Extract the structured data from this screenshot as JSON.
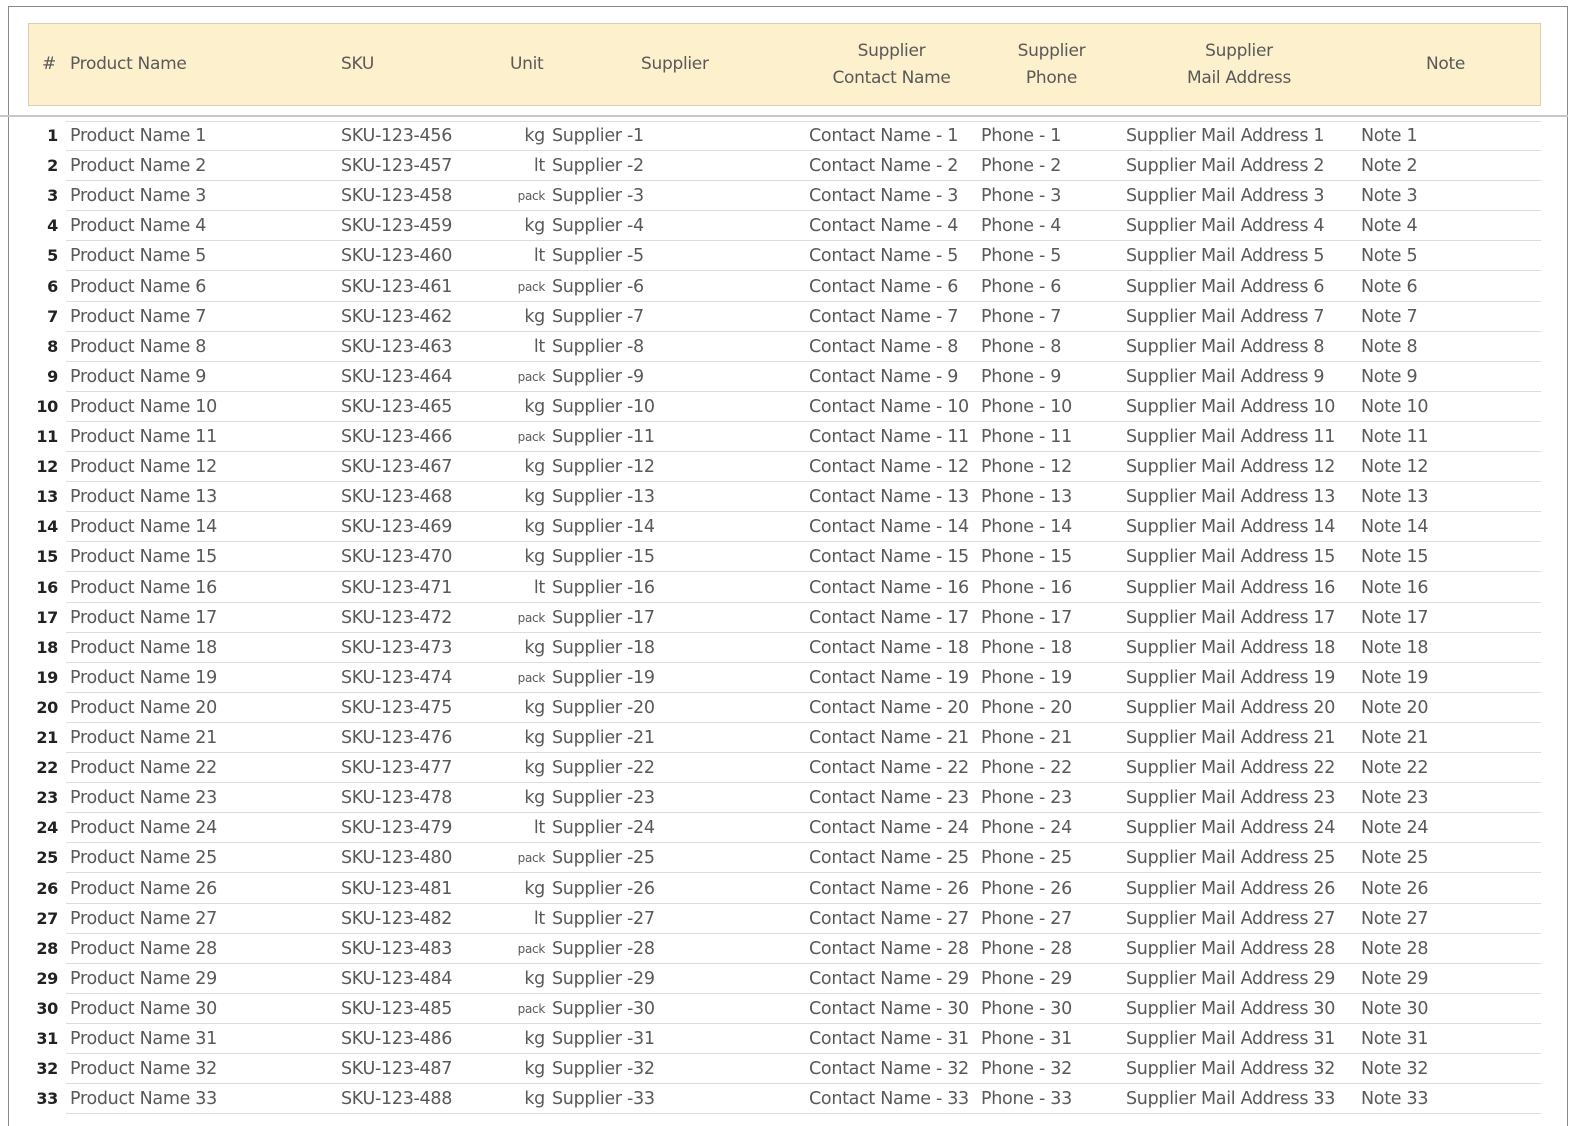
{
  "headers": {
    "num": "#",
    "product": "Product Name",
    "sku": "SKU",
    "unit": "Unit",
    "supplier": "Supplier",
    "contact_1": "Supplier",
    "contact_2": "Contact Name",
    "phone_1": "Supplier",
    "phone_2": "Phone",
    "mail_1": "Supplier",
    "mail_2": "Mail Address",
    "note": "Note"
  },
  "rows": [
    [
      "1",
      "Product Name 1",
      "SKU-123-456",
      "kg",
      "Supplier -1",
      "Contact Name - 1",
      "Phone - 1",
      "Supplier Mail Address 1",
      "Note 1"
    ],
    [
      "2",
      "Product Name 2",
      "SKU-123-457",
      "lt",
      "Supplier -2",
      "Contact Name - 2",
      "Phone - 2",
      "Supplier Mail Address 2",
      "Note 2"
    ],
    [
      "3",
      "Product Name 3",
      "SKU-123-458",
      "pack",
      "Supplier -3",
      "Contact Name - 3",
      "Phone - 3",
      "Supplier Mail Address 3",
      "Note 3"
    ],
    [
      "4",
      "Product Name 4",
      "SKU-123-459",
      "kg",
      "Supplier -4",
      "Contact Name - 4",
      "Phone - 4",
      "Supplier Mail Address 4",
      "Note 4"
    ],
    [
      "5",
      "Product Name 5",
      "SKU-123-460",
      "lt",
      "Supplier -5",
      "Contact Name - 5",
      "Phone - 5",
      "Supplier Mail Address 5",
      "Note 5"
    ],
    [
      "6",
      "Product Name 6",
      "SKU-123-461",
      "pack",
      "Supplier -6",
      "Contact Name - 6",
      "Phone - 6",
      "Supplier Mail Address 6",
      "Note 6"
    ],
    [
      "7",
      "Product Name 7",
      "SKU-123-462",
      "kg",
      "Supplier -7",
      "Contact Name - 7",
      "Phone - 7",
      "Supplier Mail Address 7",
      "Note 7"
    ],
    [
      "8",
      "Product Name 8",
      "SKU-123-463",
      "lt",
      "Supplier -8",
      "Contact Name - 8",
      "Phone - 8",
      "Supplier Mail Address 8",
      "Note 8"
    ],
    [
      "9",
      "Product Name 9",
      "SKU-123-464",
      "pack",
      "Supplier -9",
      "Contact Name - 9",
      "Phone - 9",
      "Supplier Mail Address 9",
      "Note 9"
    ],
    [
      "10",
      "Product Name 10",
      "SKU-123-465",
      "kg",
      "Supplier -10",
      "Contact Name - 10",
      "Phone - 10",
      "Supplier Mail Address 10",
      "Note 10"
    ],
    [
      "11",
      "Product Name 11",
      "SKU-123-466",
      "pack",
      "Supplier -11",
      "Contact Name - 11",
      "Phone - 11",
      "Supplier Mail Address 11",
      "Note 11"
    ],
    [
      "12",
      "Product Name 12",
      "SKU-123-467",
      "kg",
      "Supplier -12",
      "Contact Name - 12",
      "Phone - 12",
      "Supplier Mail Address 12",
      "Note 12"
    ],
    [
      "13",
      "Product Name 13",
      "SKU-123-468",
      "kg",
      "Supplier -13",
      "Contact Name - 13",
      "Phone - 13",
      "Supplier Mail Address 13",
      "Note 13"
    ],
    [
      "14",
      "Product Name 14",
      "SKU-123-469",
      "kg",
      "Supplier -14",
      "Contact Name - 14",
      "Phone - 14",
      "Supplier Mail Address 14",
      "Note 14"
    ],
    [
      "15",
      "Product Name 15",
      "SKU-123-470",
      "kg",
      "Supplier -15",
      "Contact Name - 15",
      "Phone - 15",
      "Supplier Mail Address 15",
      "Note 15"
    ],
    [
      "16",
      "Product Name 16",
      "SKU-123-471",
      "lt",
      "Supplier -16",
      "Contact Name - 16",
      "Phone - 16",
      "Supplier Mail Address 16",
      "Note 16"
    ],
    [
      "17",
      "Product Name 17",
      "SKU-123-472",
      "pack",
      "Supplier -17",
      "Contact Name - 17",
      "Phone - 17",
      "Supplier Mail Address 17",
      "Note 17"
    ],
    [
      "18",
      "Product Name 18",
      "SKU-123-473",
      "kg",
      "Supplier -18",
      "Contact Name - 18",
      "Phone - 18",
      "Supplier Mail Address 18",
      "Note 18"
    ],
    [
      "19",
      "Product Name 19",
      "SKU-123-474",
      "pack",
      "Supplier -19",
      "Contact Name - 19",
      "Phone - 19",
      "Supplier Mail Address 19",
      "Note 19"
    ],
    [
      "20",
      "Product Name 20",
      "SKU-123-475",
      "kg",
      "Supplier -20",
      "Contact Name - 20",
      "Phone - 20",
      "Supplier Mail Address 20",
      "Note 20"
    ],
    [
      "21",
      "Product Name 21",
      "SKU-123-476",
      "kg",
      "Supplier -21",
      "Contact Name - 21",
      "Phone - 21",
      "Supplier Mail Address 21",
      "Note 21"
    ],
    [
      "22",
      "Product Name 22",
      "SKU-123-477",
      "kg",
      "Supplier -22",
      "Contact Name - 22",
      "Phone - 22",
      "Supplier Mail Address 22",
      "Note 22"
    ],
    [
      "23",
      "Product Name 23",
      "SKU-123-478",
      "kg",
      "Supplier -23",
      "Contact Name - 23",
      "Phone - 23",
      "Supplier Mail Address 23",
      "Note 23"
    ],
    [
      "24",
      "Product Name 24",
      "SKU-123-479",
      "lt",
      "Supplier -24",
      "Contact Name - 24",
      "Phone - 24",
      "Supplier Mail Address 24",
      "Note 24"
    ],
    [
      "25",
      "Product Name 25",
      "SKU-123-480",
      "pack",
      "Supplier -25",
      "Contact Name - 25",
      "Phone - 25",
      "Supplier Mail Address 25",
      "Note 25"
    ],
    [
      "26",
      "Product Name 26",
      "SKU-123-481",
      "kg",
      "Supplier -26",
      "Contact Name - 26",
      "Phone - 26",
      "Supplier Mail Address 26",
      "Note 26"
    ],
    [
      "27",
      "Product Name 27",
      "SKU-123-482",
      "lt",
      "Supplier -27",
      "Contact Name - 27",
      "Phone - 27",
      "Supplier Mail Address 27",
      "Note 27"
    ],
    [
      "28",
      "Product Name 28",
      "SKU-123-483",
      "pack",
      "Supplier -28",
      "Contact Name - 28",
      "Phone - 28",
      "Supplier Mail Address 28",
      "Note 28"
    ],
    [
      "29",
      "Product Name 29",
      "SKU-123-484",
      "kg",
      "Supplier -29",
      "Contact Name - 29",
      "Phone - 29",
      "Supplier Mail Address 29",
      "Note 29"
    ],
    [
      "30",
      "Product Name 30",
      "SKU-123-485",
      "pack",
      "Supplier -30",
      "Contact Name - 30",
      "Phone - 30",
      "Supplier Mail Address 30",
      "Note 30"
    ],
    [
      "31",
      "Product Name 31",
      "SKU-123-486",
      "kg",
      "Supplier -31",
      "Contact Name - 31",
      "Phone - 31",
      "Supplier Mail Address 31",
      "Note 31"
    ],
    [
      "32",
      "Product Name 32",
      "SKU-123-487",
      "kg",
      "Supplier -32",
      "Contact Name - 32",
      "Phone - 32",
      "Supplier Mail Address 32",
      "Note 32"
    ],
    [
      "33",
      "Product Name 33",
      "SKU-123-488",
      "kg",
      "Supplier -33",
      "Contact Name - 33",
      "Phone - 33",
      "Supplier Mail Address 33",
      "Note 33"
    ]
  ]
}
